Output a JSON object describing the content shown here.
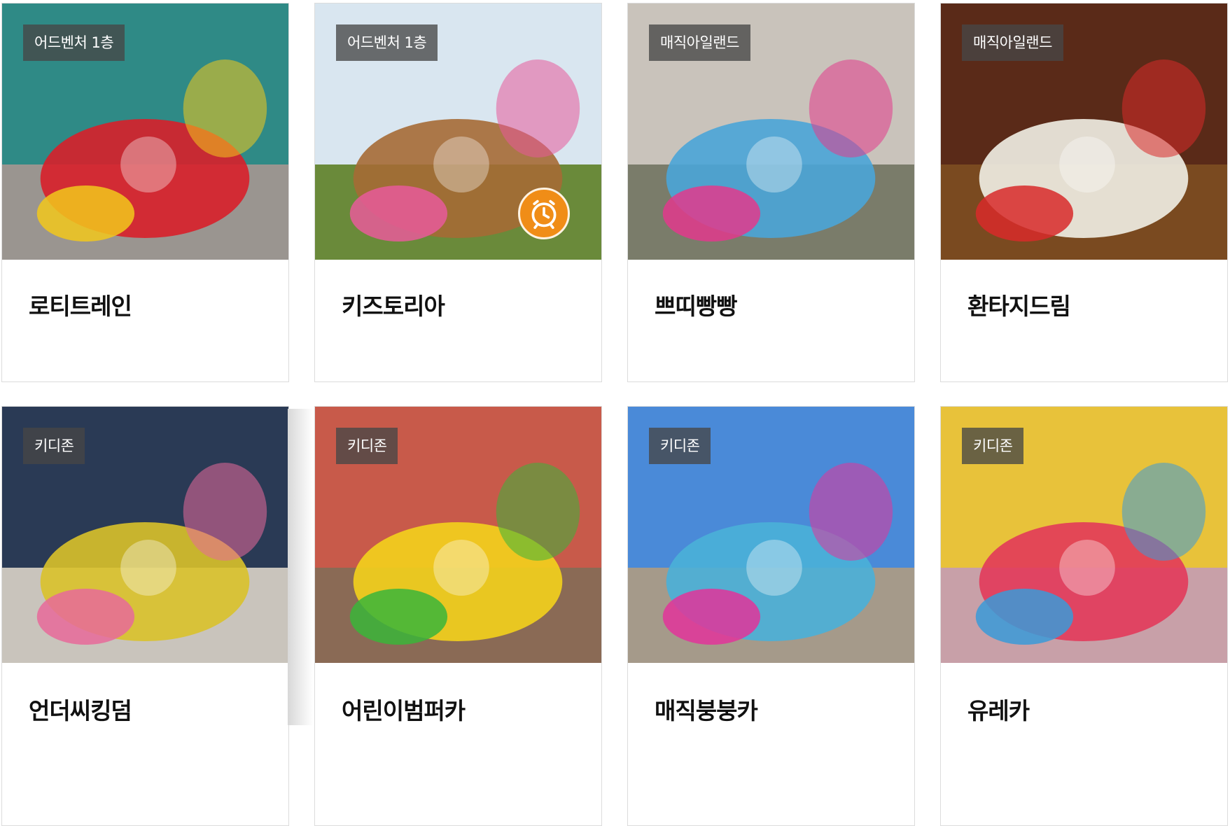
{
  "cards": [
    {
      "badge": "어드벤처 1층",
      "title": "로티트레인",
      "has_clock": false,
      "colors": {
        "sky": "#2f8a86",
        "main": "#d81f2a",
        "accent": "#f2c81c",
        "floor": "#9a9590"
      }
    },
    {
      "badge": "어드벤처 1층",
      "title": "키즈토리아",
      "has_clock": true,
      "colors": {
        "sky": "#d9e6f0",
        "main": "#a56a35",
        "accent": "#e85a9a",
        "floor": "#6a8a3a"
      }
    },
    {
      "badge": "매직아일랜드",
      "title": "쁘띠빵빵",
      "has_clock": false,
      "colors": {
        "sky": "#c9c3bb",
        "main": "#4aa5d8",
        "accent": "#e23a8c",
        "floor": "#7a7c6a"
      }
    },
    {
      "badge": "매직아일랜드",
      "title": "환타지드림",
      "has_clock": false,
      "colors": {
        "sky": "#5a2a18",
        "main": "#f1efe6",
        "accent": "#d82a2a",
        "floor": "#7a4a20"
      }
    },
    {
      "badge": "키디존",
      "title": "언더씨킹덤",
      "has_clock": false,
      "colors": {
        "sky": "#2a3a55",
        "main": "#d9c22a",
        "accent": "#e86a9a",
        "floor": "#c9c4bc"
      }
    },
    {
      "badge": "키디존",
      "title": "어린이범퍼카",
      "has_clock": false,
      "colors": {
        "sky": "#c85a4a",
        "main": "#f3d21c",
        "accent": "#3ab53a",
        "floor": "#8a6a55"
      }
    },
    {
      "badge": "키디존",
      "title": "매직붕붕카",
      "has_clock": false,
      "colors": {
        "sky": "#4a8ad8",
        "main": "#4ab0d8",
        "accent": "#e2349a",
        "floor": "#a59a8a"
      }
    },
    {
      "badge": "키디존",
      "title": "유레카",
      "has_clock": false,
      "colors": {
        "sky": "#e8c23a",
        "main": "#e23a5a",
        "accent": "#3a9ad8",
        "floor": "#c8a0a8"
      }
    }
  ],
  "icons": {
    "clock": "alarm-clock-icon"
  }
}
